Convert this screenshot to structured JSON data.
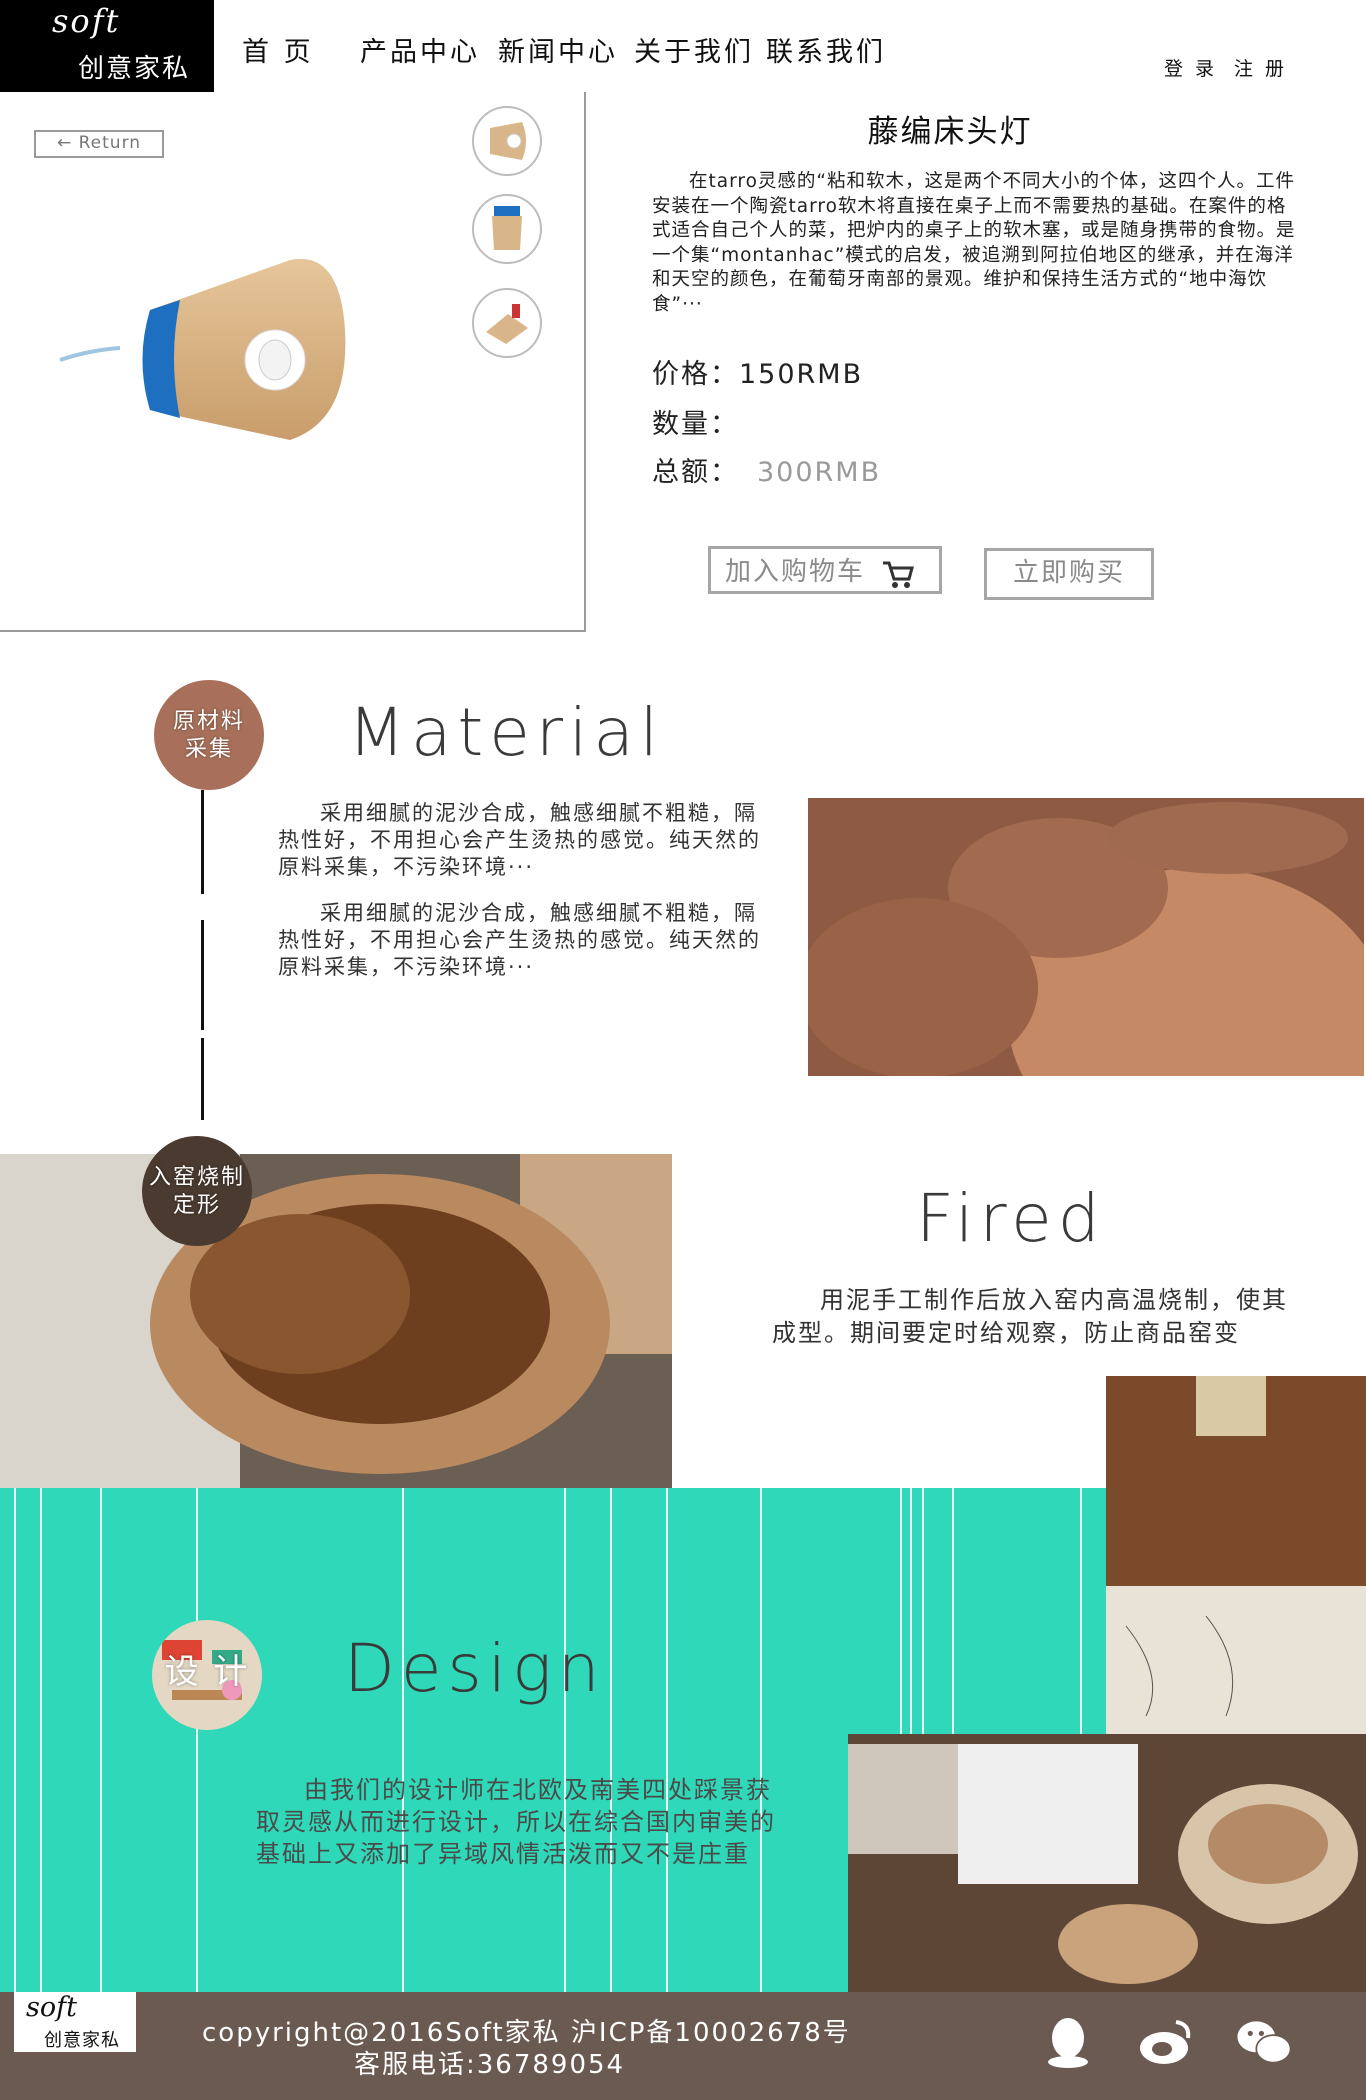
{
  "header": {
    "brand_en": "soft",
    "brand_cn": "创意家私",
    "nav": [
      "首 页",
      "产品中心",
      "新闻中心",
      "关于我们",
      "联系我们"
    ],
    "login": "登 录",
    "register": "注 册"
  },
  "product": {
    "return_label": "← Return",
    "title": "藤编床头灯",
    "description": "在tarro灵感的“粘和软木，这是两个不同大小的个体，这四个人。工件安装在一个陶瓷tarro软木将直接在桌子上而不需要热的基础。在案件的格式适合自己个人的菜，把炉内的桌子上的软木塞，或是随身携带的食物。是一个集“montanhac”模式的启发，被追溯到阿拉伯地区的继承，并在海洋和天空的颜色，在葡萄牙南部的景观。维护和保持生活方式的“地中海饮食”···",
    "price_label": "价格：",
    "price_value": "150RMB",
    "qty_label": "数量：",
    "total_label": "总额：",
    "total_value": "300RMB",
    "add_to_cart": "加入购物车",
    "buy_now": "立即购买"
  },
  "sections": {
    "material": {
      "badge": [
        "原材料",
        "采集"
      ],
      "title": "Material",
      "para1": "采用细腻的泥沙合成，触感细腻不粗糙，隔热性好，不用担心会产生烫热的感觉。纯天然的原料采集，不污染环境···",
      "para2": "采用细腻的泥沙合成，触感细腻不粗糙，隔热性好，不用担心会产生烫热的感觉。纯天然的原料采集，不污染环境···"
    },
    "fired": {
      "badge": [
        "入窑烧制",
        "定形"
      ],
      "title": "Fired",
      "para": "用泥手工制作后放入窑内高温烧制，使其成型。期间要定时给观察，防止商品窑变"
    },
    "design": {
      "badge": [
        "设 计"
      ],
      "title": "Design",
      "para": "由我们的设计师在北欧及南美四处踩景获取灵感从而进行设计，所以在综合国内审美的基础上又添加了异域风情活泼而又不是庄重"
    }
  },
  "footer": {
    "logo_en": "soft",
    "logo_cn": "创意家私",
    "copyright": "copyright@2016Soft家私 沪ICP备10002678号",
    "service": "客服电话:36789054"
  },
  "icons": [
    "qq-icon",
    "weibo-icon",
    "wechat-icon",
    "cart-icon"
  ],
  "colors": {
    "teal": "#2fd8b8",
    "footer": "#6b5a52",
    "cork": "#d9b58a",
    "blue": "#1f6fc0"
  }
}
